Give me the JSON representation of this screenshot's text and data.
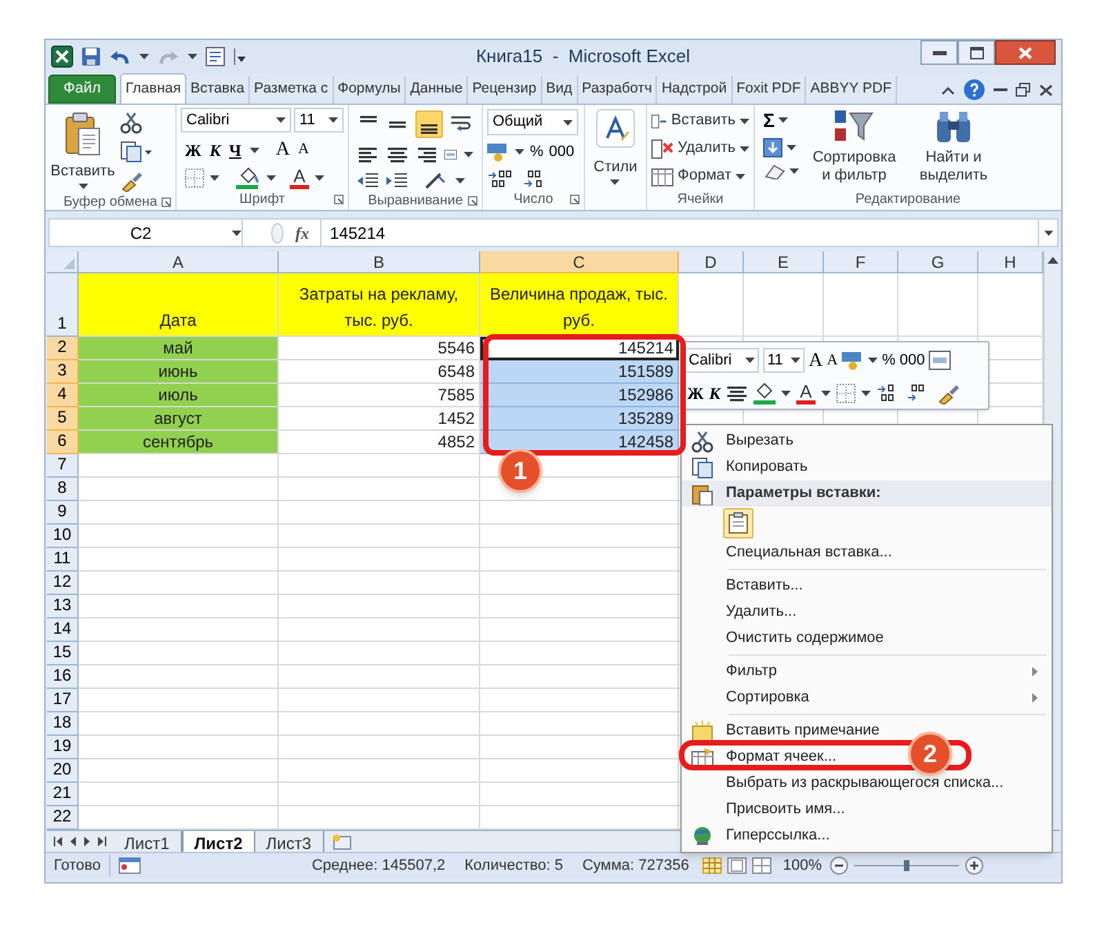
{
  "window": {
    "title": "Книга15  -  Microsoft Excel"
  },
  "tabs": [
    {
      "label": "Файл",
      "kind": "file",
      "selected": false
    },
    {
      "label": "Главная",
      "kind": "tab",
      "selected": true
    },
    {
      "label": "Вставка",
      "kind": "tab",
      "selected": false
    },
    {
      "label": "Разметка с",
      "kind": "tab",
      "selected": false
    },
    {
      "label": "Формулы",
      "kind": "tab",
      "selected": false
    },
    {
      "label": "Данные",
      "kind": "tab",
      "selected": false
    },
    {
      "label": "Рецензир",
      "kind": "tab",
      "selected": false
    },
    {
      "label": "Вид",
      "kind": "tab",
      "selected": false
    },
    {
      "label": "Разработч",
      "kind": "tab",
      "selected": false
    },
    {
      "label": "Надстрой",
      "kind": "tab",
      "selected": false
    },
    {
      "label": "Foxit PDF",
      "kind": "tab",
      "selected": false
    },
    {
      "label": "ABBYY PDF",
      "kind": "tab",
      "selected": false
    }
  ],
  "ribbon": {
    "clipboard": {
      "paste": "Вставить",
      "label": "Буфер обмена"
    },
    "font": {
      "name": "Calibri",
      "size": "11",
      "bold": "Ж",
      "italic": "К",
      "underline": "Ч",
      "grow": "A",
      "shrink": "A",
      "font_color": "A",
      "label": "Шрифт"
    },
    "alignment": {
      "bottom_aligned": true,
      "label": "Выравнивание"
    },
    "number": {
      "format": "Общий",
      "percent": "%",
      "thousands": "000",
      "label": "Число"
    },
    "styles": {
      "button": "Стили"
    },
    "cells": {
      "buttons": [
        "Вставить",
        "Удалить",
        "Формат"
      ],
      "label": "Ячейки"
    },
    "editing": {
      "sum": "Σ",
      "sort": "Сортировка и фильтр",
      "find": "Найти и выделить",
      "label": "Редактирование"
    }
  },
  "formula_bar": {
    "name_box": "C2",
    "fx": "fx",
    "value": "145214"
  },
  "sheet": {
    "columns": [
      {
        "label": "A",
        "selected": false
      },
      {
        "label": "B",
        "selected": false
      },
      {
        "label": "C",
        "selected": true
      },
      {
        "label": "D",
        "selected": false
      },
      {
        "label": "E",
        "selected": false
      },
      {
        "label": "F",
        "selected": false
      },
      {
        "label": "G",
        "selected": false
      },
      {
        "label": "H",
        "selected": false
      }
    ],
    "rows": [
      {
        "header": "1",
        "selected": false,
        "cells": [
          {
            "text": "Дата",
            "kind": "label",
            "color": "#ffff00",
            "selected": false
          },
          {
            "text": "Затраты на рекламу, тыс. руб.",
            "kind": "label",
            "color": "#ffff00",
            "selected": false
          },
          {
            "text": "Величина продаж, тыс. руб.",
            "kind": "label",
            "color": "#ffff00",
            "selected": false
          }
        ]
      },
      {
        "header": "2",
        "selected": true,
        "cells": [
          {
            "text": "май",
            "kind": "label",
            "color": "#92d050",
            "selected": false
          },
          {
            "text": "5546",
            "kind": "number",
            "selected": false
          },
          {
            "text": "145214",
            "kind": "number",
            "selected": true,
            "active": true
          }
        ]
      },
      {
        "header": "3",
        "selected": true,
        "cells": [
          {
            "text": "июнь",
            "kind": "label",
            "color": "#92d050",
            "selected": false
          },
          {
            "text": "6548",
            "kind": "number",
            "selected": false
          },
          {
            "text": "151589",
            "kind": "number",
            "selected": true,
            "active": false
          }
        ]
      },
      {
        "header": "4",
        "selected": true,
        "cells": [
          {
            "text": "июль",
            "kind": "label",
            "color": "#92d050",
            "selected": false
          },
          {
            "text": "7585",
            "kind": "number",
            "selected": false
          },
          {
            "text": "152986",
            "kind": "number",
            "selected": true,
            "active": false
          }
        ]
      },
      {
        "header": "5",
        "selected": true,
        "cells": [
          {
            "text": "август",
            "kind": "label",
            "color": "#92d050",
            "selected": false
          },
          {
            "text": "1452",
            "kind": "number",
            "selected": false
          },
          {
            "text": "135289",
            "kind": "number",
            "selected": true,
            "active": false
          }
        ]
      },
      {
        "header": "6",
        "selected": true,
        "cells": [
          {
            "text": "сентябрь",
            "kind": "label",
            "color": "#92d050",
            "selected": false
          },
          {
            "text": "4852",
            "kind": "number",
            "selected": false
          },
          {
            "text": "142458",
            "kind": "number",
            "selected": true,
            "active": false
          }
        ]
      },
      {
        "header": "7",
        "selected": false
      },
      {
        "header": "8",
        "selected": false
      },
      {
        "header": "9",
        "selected": false
      },
      {
        "header": "10",
        "selected": false
      },
      {
        "header": "11",
        "selected": false
      },
      {
        "header": "12",
        "selected": false
      },
      {
        "header": "13",
        "selected": false
      },
      {
        "header": "14",
        "selected": false
      },
      {
        "header": "15",
        "selected": false
      },
      {
        "header": "16",
        "selected": false
      },
      {
        "header": "17",
        "selected": false
      },
      {
        "header": "18",
        "selected": false
      },
      {
        "header": "19",
        "selected": false
      },
      {
        "header": "20",
        "selected": false
      },
      {
        "header": "21",
        "selected": false
      },
      {
        "header": "22",
        "selected": false
      }
    ]
  },
  "sheet_tabs": [
    {
      "label": "Лист1",
      "selected": false
    },
    {
      "label": "Лист2",
      "selected": true
    },
    {
      "label": "Лист3",
      "selected": false
    }
  ],
  "status_bar": {
    "ready": "Готово",
    "average": "Среднее: 145507,2",
    "count": "Количество: 5",
    "sum": "Сумма: 727356",
    "zoom": "100%"
  },
  "mini_toolbar": {
    "font": "Calibri",
    "size": "11",
    "grow": "A",
    "shrink": "A",
    "percent": "%",
    "thousands": "000",
    "bold": "Ж",
    "italic": "К",
    "font_color": "A"
  },
  "context_menu": [
    {
      "kind": "item",
      "label": "Вырезать"
    },
    {
      "kind": "item",
      "label": "Копировать"
    },
    {
      "kind": "header",
      "label": "Параметры вставки:"
    },
    {
      "kind": "paste_options"
    },
    {
      "kind": "item",
      "label": "Специальная вставка..."
    },
    {
      "kind": "separator"
    },
    {
      "kind": "item",
      "label": "Вставить..."
    },
    {
      "kind": "item",
      "label": "Удалить..."
    },
    {
      "kind": "item",
      "label": "Очистить содержимое"
    },
    {
      "kind": "separator"
    },
    {
      "kind": "submenu",
      "label": "Фильтр"
    },
    {
      "kind": "submenu",
      "label": "Сортировка"
    },
    {
      "kind": "separator"
    },
    {
      "kind": "item",
      "label": "Вставить примечание"
    },
    {
      "kind": "item",
      "label": "Формат ячеек..."
    },
    {
      "kind": "item",
      "label": "Выбрать из раскрывающегося списка..."
    },
    {
      "kind": "item",
      "label": "Присвоить имя..."
    },
    {
      "kind": "item",
      "label": "Гиперссылка..."
    }
  ],
  "callouts": [
    {
      "number": "1"
    },
    {
      "number": "2"
    }
  ]
}
